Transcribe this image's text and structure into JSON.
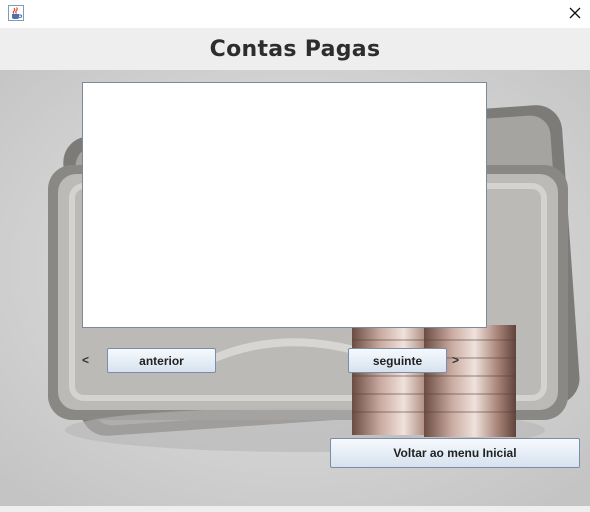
{
  "window": {
    "app_icon": "java-coffee-cup-icon",
    "close_icon": "close-icon"
  },
  "header": {
    "title": "Contas Pagas"
  },
  "list": {
    "items": []
  },
  "navigation": {
    "prev_arrow": "<",
    "prev_label": "anterior",
    "next_label": "seguinte",
    "next_arrow": ">"
  },
  "footer": {
    "back_label": "Voltar ao menu Inicial"
  },
  "colors": {
    "content_bg": "#c9c9c9",
    "header_bg": "#eeeeee",
    "title_text": "#2d2d2d",
    "button_border": "#7a8ea8"
  }
}
